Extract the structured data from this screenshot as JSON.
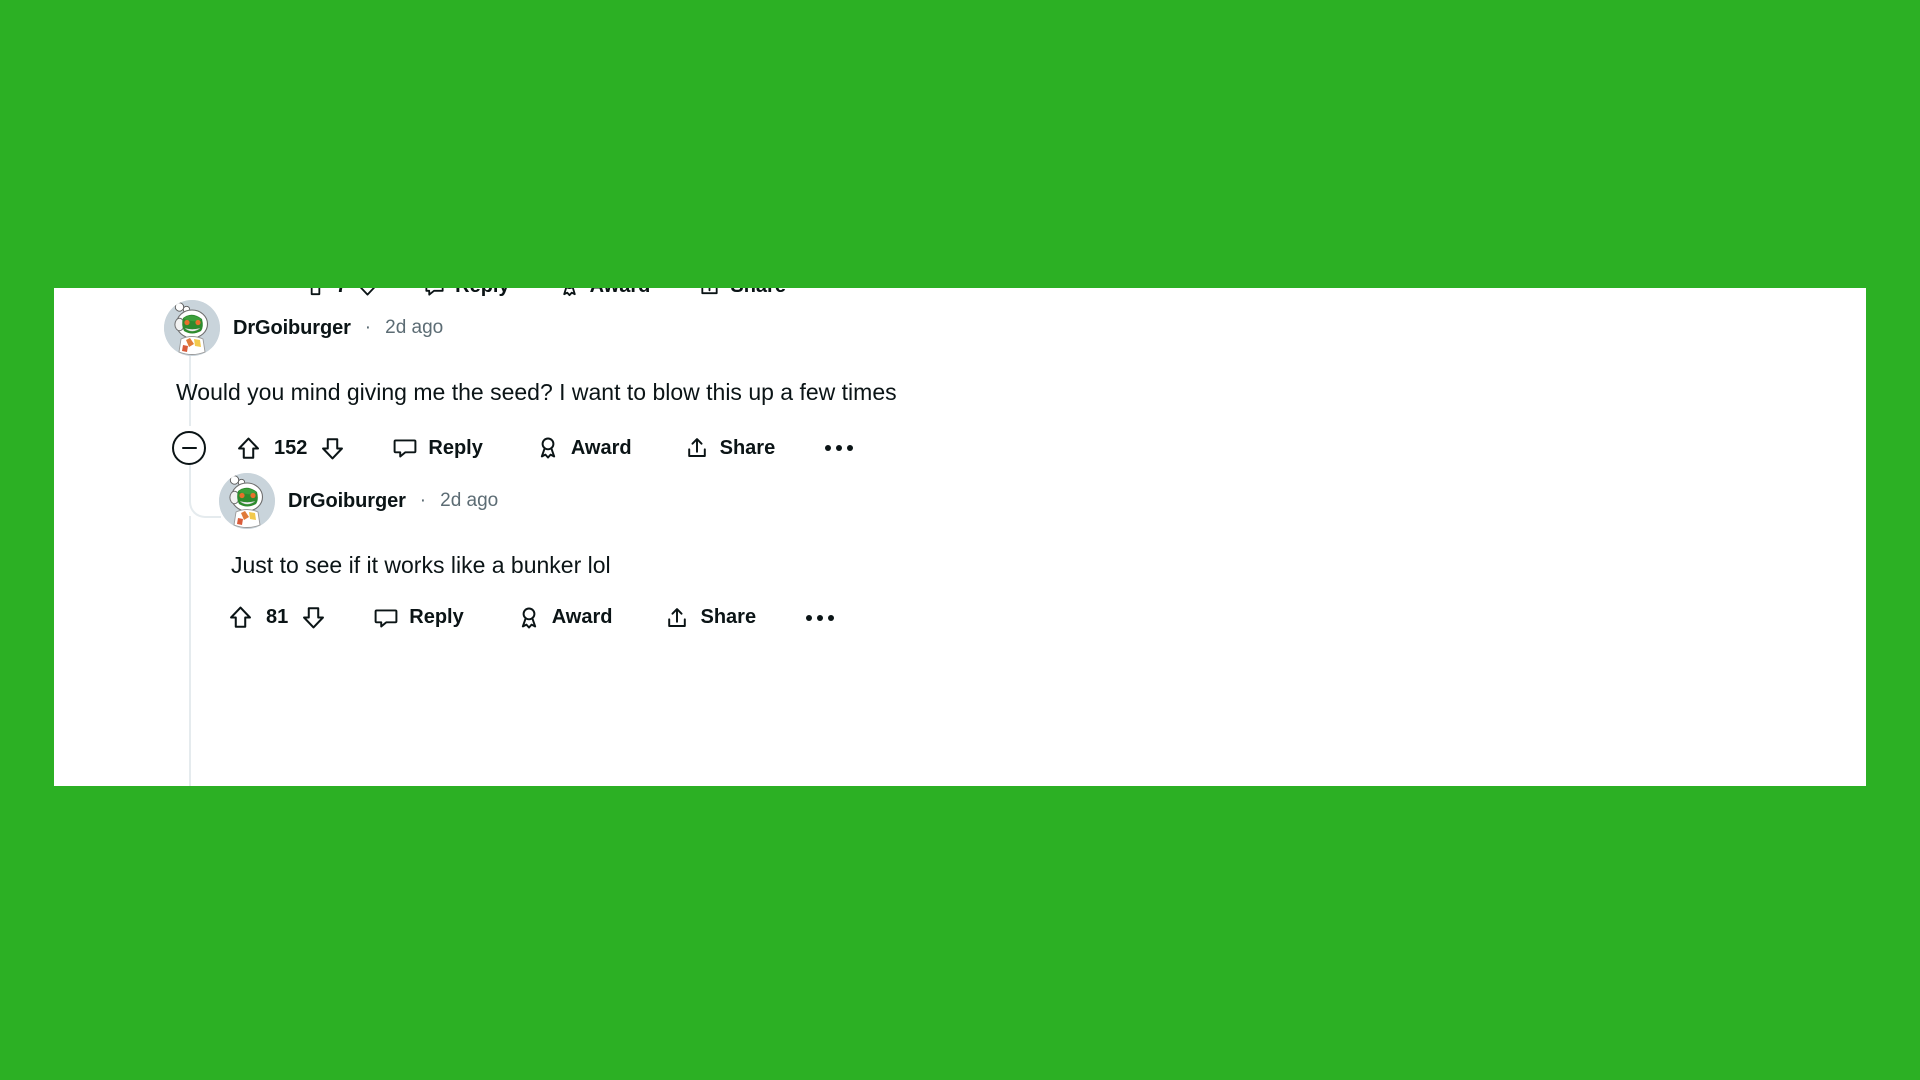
{
  "page": {
    "background_color": "#2CB024",
    "card_background": "#FFFFFF",
    "text_color": "#0B1416",
    "muted_color": "#5C6C74",
    "thread_line_color": "#E5EBEE"
  },
  "cutoff_row": {
    "reply_label": "Reply",
    "award_label": "Award",
    "share_label": "Share"
  },
  "comments": [
    {
      "username": "DrGoiburger",
      "separator": "·",
      "timestamp": "2d ago",
      "body": "Would you mind giving me the seed? I want to blow this up a few times",
      "vote_count": "152",
      "reply_label": "Reply",
      "award_label": "Award",
      "share_label": "Share",
      "avatar_name": "reddit-snoo-alien-avatar"
    },
    {
      "username": "DrGoiburger",
      "separator": "·",
      "timestamp": "2d ago",
      "body": "Just to see if it works like a bunker lol",
      "vote_count": "81",
      "reply_label": "Reply",
      "award_label": "Award",
      "share_label": "Share",
      "avatar_name": "reddit-snoo-alien-avatar"
    }
  ]
}
